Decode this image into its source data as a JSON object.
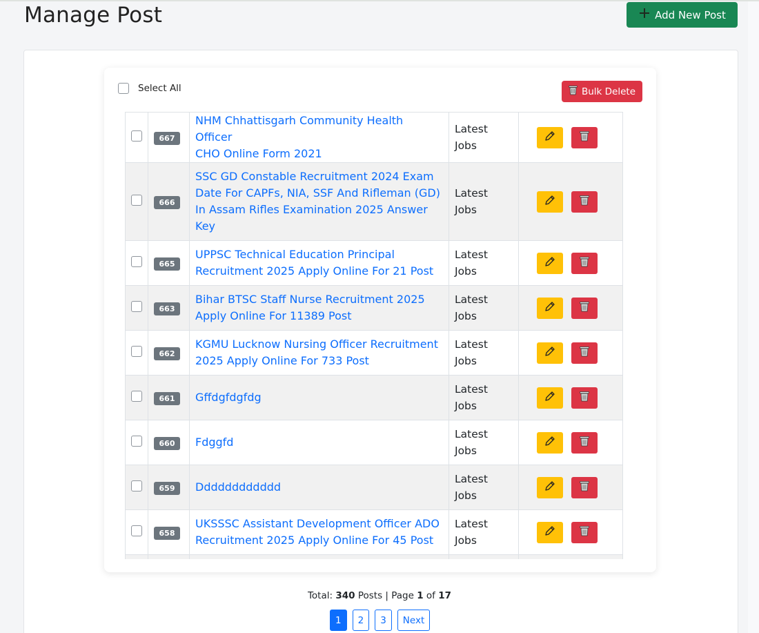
{
  "header": {
    "title": "Manage Post",
    "add_button_label": "Add New Post",
    "add_button_icon": "plus-icon"
  },
  "toolbar": {
    "select_all_label": "Select All",
    "bulk_delete_label": "Bulk Delete",
    "bulk_delete_icon": "trash-icon"
  },
  "posts": [
    {
      "id": "667",
      "title_lines": [
        "NHM Chhattisgarh Community Health Officer",
        "CHO Online Form 2021"
      ],
      "category_lines": [
        "Latest",
        "Jobs"
      ]
    },
    {
      "id": "666",
      "title_lines": [
        "SSC GD Constable Recruitment 2024 Exam",
        "Date For CAPFs, NIA, SSF And Rifleman (GD)",
        "In Assam Rifles Examination 2025 Answer",
        "Key"
      ],
      "category_lines": [
        "Latest",
        "Jobs"
      ]
    },
    {
      "id": "665",
      "title_lines": [
        "UPPSC Technical Education Principal",
        "Recruitment 2025 Apply Online For 21 Post"
      ],
      "category_lines": [
        "Latest",
        "Jobs"
      ]
    },
    {
      "id": "663",
      "title_lines": [
        "Bihar BTSC Staff Nurse Recruitment 2025",
        "Apply Online For 11389 Post"
      ],
      "category_lines": [
        "Latest",
        "Jobs"
      ]
    },
    {
      "id": "662",
      "title_lines": [
        "KGMU Lucknow Nursing Officer Recruitment",
        "2025 Apply Online For 733 Post"
      ],
      "category_lines": [
        "Latest",
        "Jobs"
      ]
    },
    {
      "id": "661",
      "title_lines": [
        "Gffdgfdgfdg"
      ],
      "category_lines": [
        "Latest",
        "Jobs"
      ]
    },
    {
      "id": "660",
      "title_lines": [
        "Fdggfd"
      ],
      "category_lines": [
        "Latest",
        "Jobs"
      ]
    },
    {
      "id": "659",
      "title_lines": [
        "Dddddddddddd"
      ],
      "category_lines": [
        "Latest",
        "Jobs"
      ]
    },
    {
      "id": "658",
      "title_lines": [
        "UKSSSC Assistant Development Officer ADO",
        "Recruitment 2025 Apply Online For 45 Post"
      ],
      "category_lines": [
        "Latest",
        "Jobs"
      ]
    }
  ],
  "row_actions": {
    "edit_icon": "pencil-icon",
    "delete_icon": "trash-icon"
  },
  "footer": {
    "total_prefix": "Total:",
    "total_count": "340",
    "posts_word": "Posts | Page",
    "current_page": "1",
    "of_word": "of",
    "page_count": "17"
  },
  "pagination": {
    "pages": [
      "1",
      "2",
      "3"
    ],
    "next_label": "Next",
    "active": "1"
  },
  "colors": {
    "add_button": "#198754",
    "bulk_delete": "#dc3545",
    "edit_button": "#ffc107",
    "delete_button": "#dc3545",
    "link": "#0d6efd",
    "id_badge": "#6c757d"
  }
}
